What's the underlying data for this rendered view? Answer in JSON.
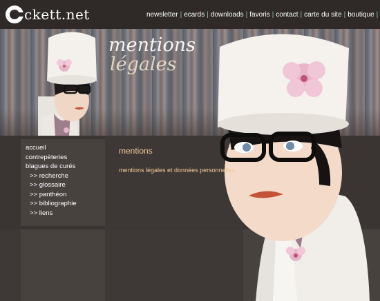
{
  "site": {
    "logo_text": "ckett.net"
  },
  "topnav": {
    "items": [
      {
        "label": "newsletter"
      },
      {
        "label": "ecards"
      },
      {
        "label": "downloads"
      },
      {
        "label": "favoris"
      },
      {
        "label": "contact"
      },
      {
        "label": "carte du site"
      },
      {
        "label": "boutique"
      }
    ],
    "separator": "|"
  },
  "banner": {
    "title_line1": "mentions",
    "title_line2": "légales"
  },
  "sidebar": {
    "items": [
      {
        "label": "accueil"
      },
      {
        "label": "contrepèteries"
      },
      {
        "label": "blagues de curés"
      },
      {
        "label": ">> recherche"
      },
      {
        "label": ">> glossaire"
      },
      {
        "label": ">> panthéon"
      },
      {
        "label": ">> bibliographie"
      },
      {
        "label": ">> liens"
      }
    ]
  },
  "content": {
    "title": "mentions",
    "link": "mentions légales et données personnelles"
  },
  "colors": {
    "accent": "#f2c89a",
    "separator": "#8fc1a6"
  }
}
